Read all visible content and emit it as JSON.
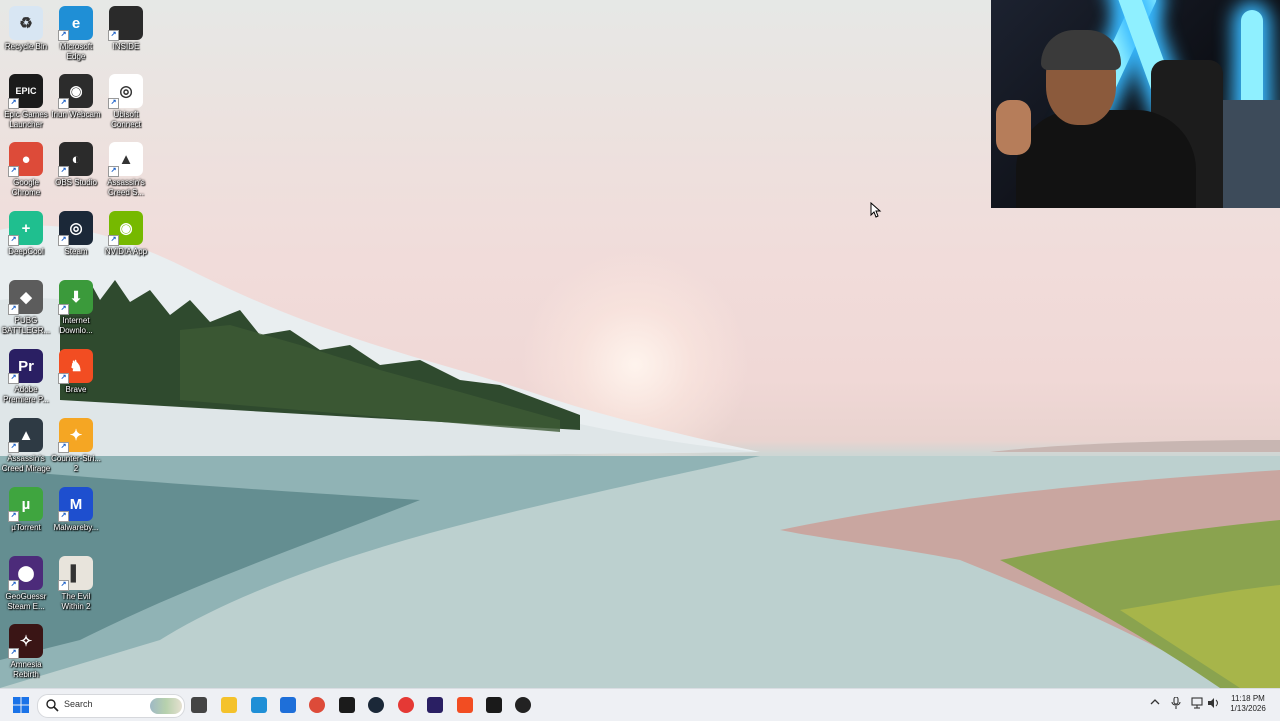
{
  "desktop": {
    "icons": [
      {
        "name": "recycle-bin-icon",
        "label": "Recycle Bin",
        "color": "#d8e6f3",
        "glyph": "♻"
      },
      {
        "name": "edge-icon",
        "label": "Microsoft Edge",
        "color": "#1f8fd6",
        "glyph": "e"
      },
      {
        "name": "inside-icon",
        "label": "INSIDE",
        "color": "#2a2a2a",
        "glyph": ""
      },
      {
        "name": "epic-games-icon",
        "label": "Epic Games Launcher",
        "color": "#1b1b1b",
        "glyph": "EPIC"
      },
      {
        "name": "iriun-webcam-icon",
        "label": "Iriun Webcam",
        "color": "#2c2c2c",
        "glyph": "◉"
      },
      {
        "name": "ubisoft-connect-icon",
        "label": "Ubisoft Connect",
        "color": "#ffffff",
        "glyph": "◎"
      },
      {
        "name": "chrome-icon",
        "label": "Google Chrome",
        "color": "#dd4b39",
        "glyph": "●"
      },
      {
        "name": "obs-icon",
        "label": "OBS Studio",
        "color": "#2b2b2b",
        "glyph": "◐"
      },
      {
        "name": "assassins-creed-icon",
        "label": "Assassin's Creed S...",
        "color": "#ffffff",
        "glyph": "▲"
      },
      {
        "name": "deepcool-icon",
        "label": "DeepCool",
        "color": "#1fbf8f",
        "glyph": "+"
      },
      {
        "name": "steam-icon",
        "label": "Steam",
        "color": "#1b2838",
        "glyph": "◎"
      },
      {
        "name": "nvidia-icon",
        "label": "NVIDIA App",
        "color": "#76b900",
        "glyph": "◉"
      },
      {
        "name": "pubg-icon",
        "label": "PUBG BATTLEGR...",
        "color": "#5c5c5c",
        "glyph": "◆"
      },
      {
        "name": "internet-download-icon",
        "label": "Internet Downlo...",
        "color": "#3b9a3b",
        "glyph": "⬇"
      },
      {
        "name": "premiere-icon",
        "label": "Adobe Premiere P...",
        "color": "#2a1f63",
        "glyph": "Pr"
      },
      {
        "name": "brave-icon",
        "label": "Brave",
        "color": "#f24d22",
        "glyph": "♞"
      },
      {
        "name": "ac-mirage-icon",
        "label": "Assassin's Creed Mirage",
        "color": "#2e3a44",
        "glyph": "▲"
      },
      {
        "name": "counter-strike-icon",
        "label": "Counter-Stri... 2",
        "color": "#f5a623",
        "glyph": "✦"
      },
      {
        "name": "utorrent-icon",
        "label": "µTorrent",
        "color": "#3fa53f",
        "glyph": "µ"
      },
      {
        "name": "malwarebytes-icon",
        "label": "Malwareby...",
        "color": "#1e4fcf",
        "glyph": "M"
      },
      {
        "name": "geoguessr-icon",
        "label": "GeoGuessr Steam E...",
        "color": "#4c2b7a",
        "glyph": "⬤"
      },
      {
        "name": "evil-within-icon",
        "label": "The Evil Within 2",
        "color": "#e8e4dc",
        "glyph": "▌"
      },
      {
        "name": "amnesia-icon",
        "label": "Amnesia Rebirth",
        "color": "#3a1515",
        "glyph": "✧"
      }
    ]
  },
  "taskbar": {
    "search_placeholder": "Search",
    "apps": [
      {
        "name": "task-view-icon",
        "color": "#444444"
      },
      {
        "name": "file-explorer-icon",
        "color": "#f4c22b"
      },
      {
        "name": "edge-taskbar-icon",
        "color": "#1f8fd6"
      },
      {
        "name": "store-taskbar-icon",
        "color": "#1e6fd9"
      },
      {
        "name": "chrome-taskbar-icon",
        "color": "#dd4b39"
      },
      {
        "name": "epic-taskbar-icon",
        "color": "#1b1b1b"
      },
      {
        "name": "steam-taskbar-icon",
        "color": "#1b2838"
      },
      {
        "name": "davinci-taskbar-icon",
        "color": "#e53935"
      },
      {
        "name": "premiere-taskbar-icon",
        "color": "#2a1f63"
      },
      {
        "name": "brave-taskbar-icon",
        "color": "#f24d22"
      },
      {
        "name": "audio-app-taskbar-icon",
        "color": "#1a1a1a"
      },
      {
        "name": "media-player-taskbar-icon",
        "color": "#222222"
      }
    ],
    "clock": {
      "time": "11:18 PM",
      "date": "1/13/2026"
    }
  }
}
